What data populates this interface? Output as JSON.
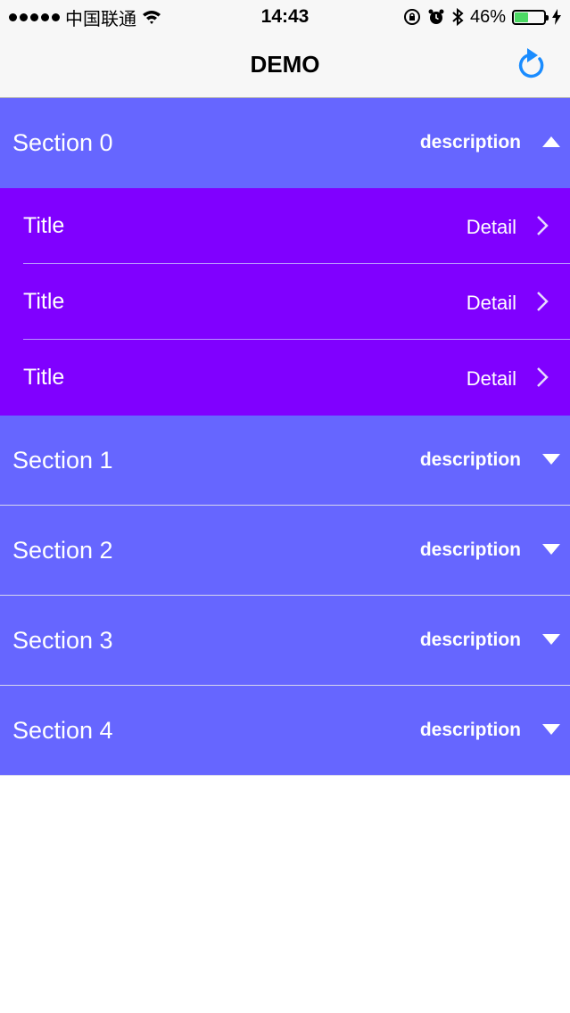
{
  "status_bar": {
    "carrier": "中国联通",
    "time": "14:43",
    "battery": "46%",
    "battery_level": 0.46,
    "icons": [
      "signal-dots-icon",
      "wifi-icon",
      "orientation-lock-icon",
      "alarm-icon",
      "bluetooth-icon",
      "battery-icon",
      "charging-icon"
    ]
  },
  "nav": {
    "title": "DEMO",
    "refresh_icon": "refresh-icon"
  },
  "colors": {
    "section_bg": "#6666ff",
    "rows_bg": "#8000ff",
    "accent": "#1a8cff"
  },
  "sections": [
    {
      "title": "Section 0",
      "description": "description",
      "expanded": true,
      "rows": [
        {
          "title": "Title",
          "detail": "Detail"
        },
        {
          "title": "Title",
          "detail": "Detail"
        },
        {
          "title": "Title",
          "detail": "Detail"
        }
      ]
    },
    {
      "title": "Section 1",
      "description": "description",
      "expanded": false
    },
    {
      "title": "Section 2",
      "description": "description",
      "expanded": false
    },
    {
      "title": "Section 3",
      "description": "description",
      "expanded": false
    },
    {
      "title": "Section 4",
      "description": "description",
      "expanded": false
    }
  ]
}
